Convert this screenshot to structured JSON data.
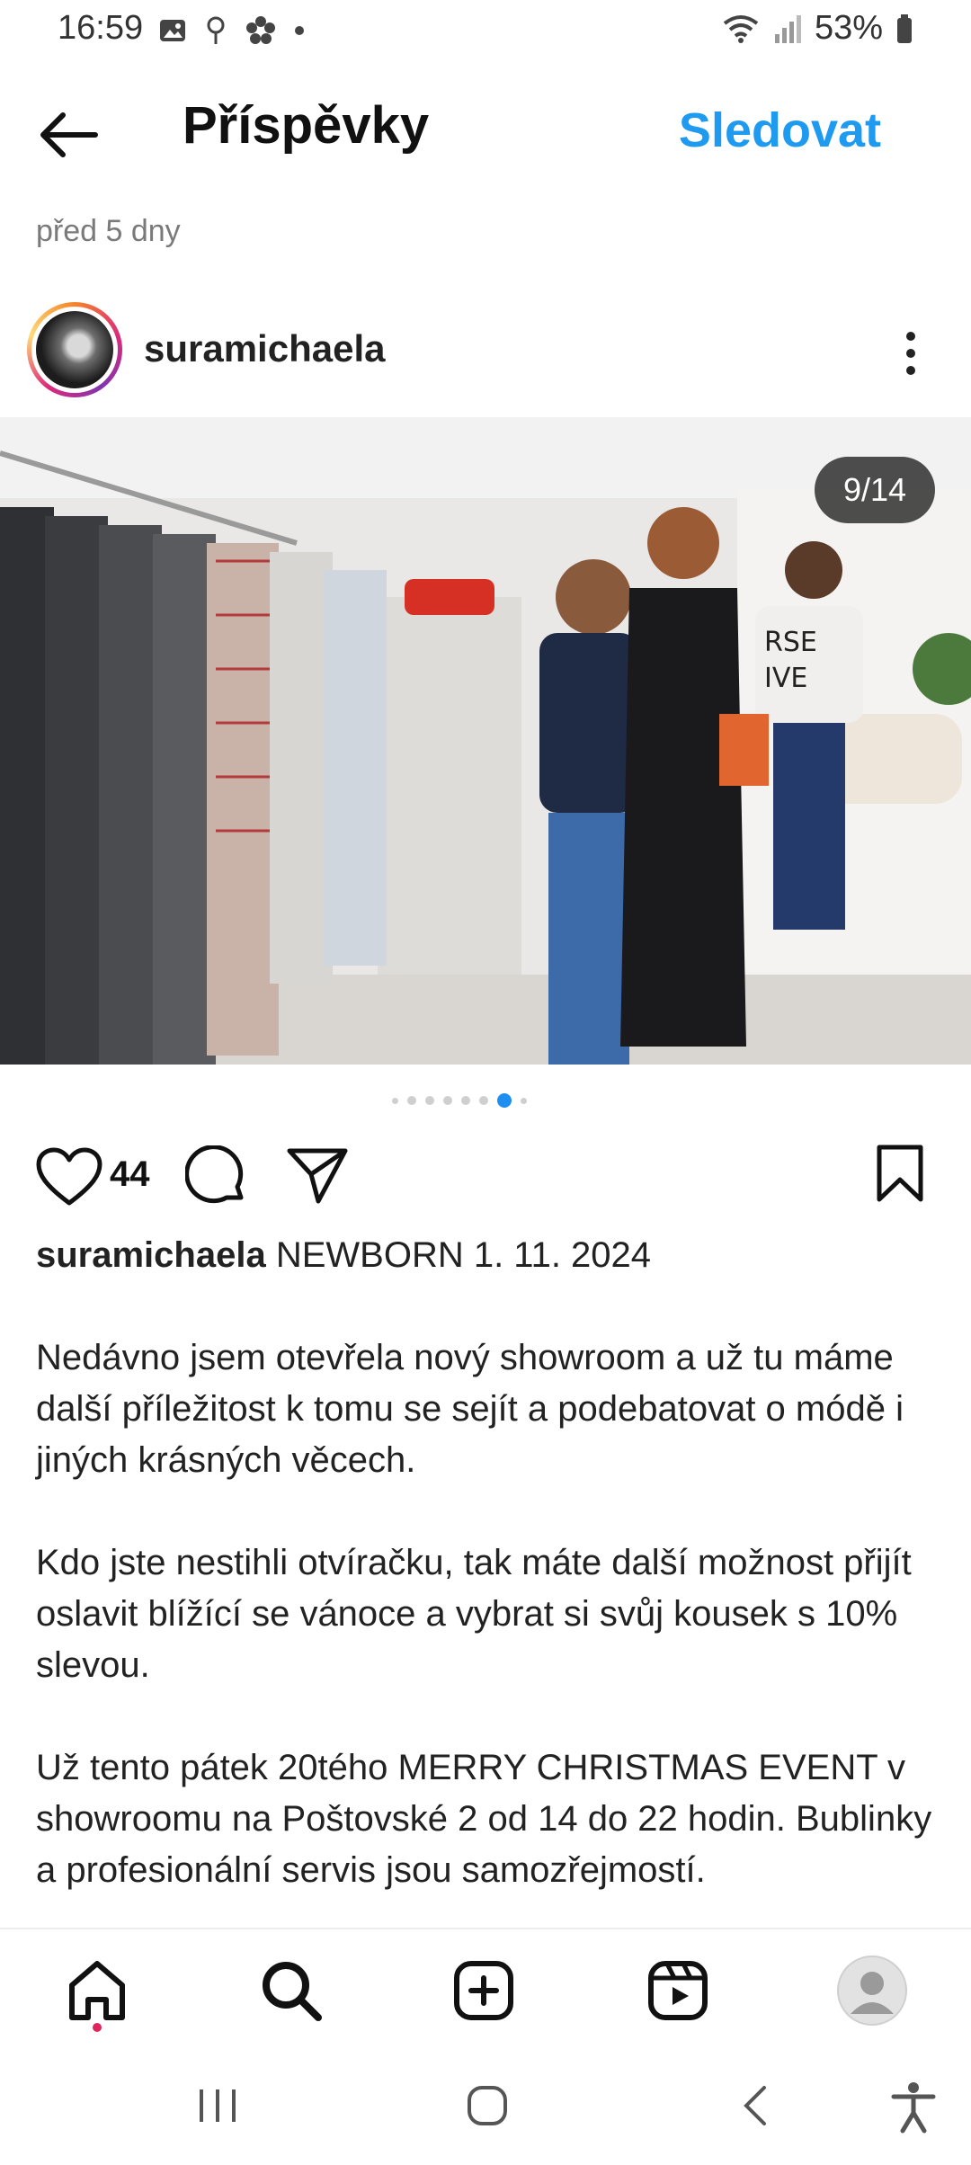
{
  "status_bar": {
    "time": "16:59",
    "battery": "53%",
    "icons": [
      "image-icon",
      "location-icon",
      "flower-icon",
      "dot-icon",
      "wifi-icon",
      "signal-icon",
      "battery-icon"
    ]
  },
  "header": {
    "title": "Příspěvky",
    "follow_label": "Sledovat"
  },
  "timeago": "před 5 dny",
  "post": {
    "username": "suramichaela",
    "image_counter": "9/14",
    "carousel": {
      "total_dots": 8,
      "active_index": 6
    },
    "likes": "44",
    "caption_user": "suramichaela",
    "caption_headline": "NEWBORN 1. 11. 2024",
    "paragraphs": [
      "Nedávno jsem otevřela nový showroom a už tu máme další příležitost k tomu se sejít a podebatovat o módě i jiných krásných věcech.",
      "Kdo jste nestihli otvíračku, tak máte další možnost přijít oslavit blížící se vánoce a vybrat si svůj kousek s 10% slevou.",
      "Už tento pátek 20tého MERRY CHRISTMAS EVENT v showroomu na Poštovské 2 od 14 do 22 hodin. Bublinky a profesionální servis jsou samozřejmostí."
    ]
  },
  "bottom_nav": [
    "home-icon",
    "search-icon",
    "create-icon",
    "reels-icon",
    "profile-icon"
  ],
  "system_nav": [
    "recents-icon",
    "home-circle-icon",
    "back-chevron-icon",
    "accessibility-icon"
  ],
  "colors": {
    "accent": "#1e9bf0",
    "notification": "#e0245e"
  }
}
